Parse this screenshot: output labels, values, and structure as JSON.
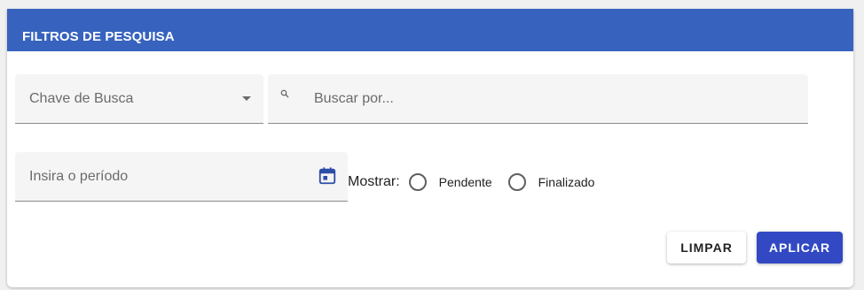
{
  "card": {
    "title": "FILTROS DE PESQUISA"
  },
  "filters": {
    "key_select": {
      "label": "Chave de Busca"
    },
    "search": {
      "placeholder": "Buscar por...",
      "value": ""
    },
    "period": {
      "label": "Insira o período"
    },
    "show": {
      "label": "Mostrar:",
      "options": [
        {
          "label": "Pendente",
          "selected": false
        },
        {
          "label": "Finalizado",
          "selected": false
        }
      ]
    }
  },
  "actions": {
    "clear_label": "LIMPAR",
    "apply_label": "APLICAR"
  },
  "colors": {
    "header": "#3762be",
    "primary_button": "#3249c3",
    "calendar_icon": "#2d4fa8"
  },
  "icons": [
    "search-icon",
    "calendar-icon",
    "dropdown-caret-icon"
  ]
}
